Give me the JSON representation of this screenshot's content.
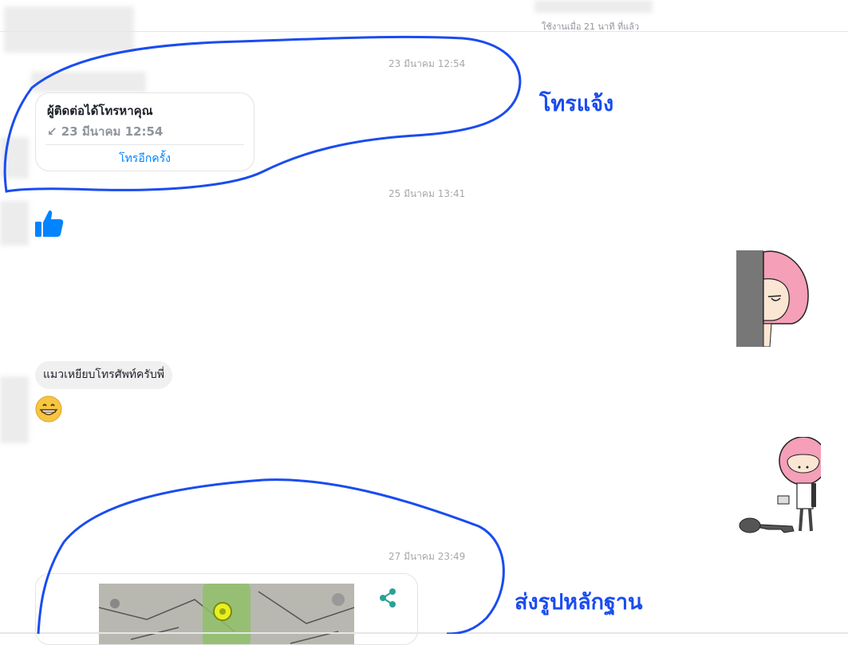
{
  "header": {
    "status_text": "ใช้งานเมื่อ 21 นาที ที่แล้ว"
  },
  "messages": {
    "timestamp_1": "23 มีนาคม 12:54",
    "missed_call": {
      "title": "ผู้ติดต่อได้โทรหาคุณ",
      "time": "↙ 23 มีนาคม 12:54",
      "callback_label": "โทรอีกครั้ง"
    },
    "timestamp_2": "25 มีนาคม 13:41",
    "text_bubble": "แมวเหยียบโทรศัพท์ครับพี่",
    "timestamp_3": "27 มีนาคม 23:49"
  },
  "annotations": {
    "annotation_1": "โทรแจ้ง",
    "annotation_2": "ส่งรูปหลักฐาน"
  },
  "colors": {
    "annotation_blue": "#1a4cf0",
    "messenger_blue": "#0084ff",
    "bubble_gray": "#f1f0f0"
  }
}
